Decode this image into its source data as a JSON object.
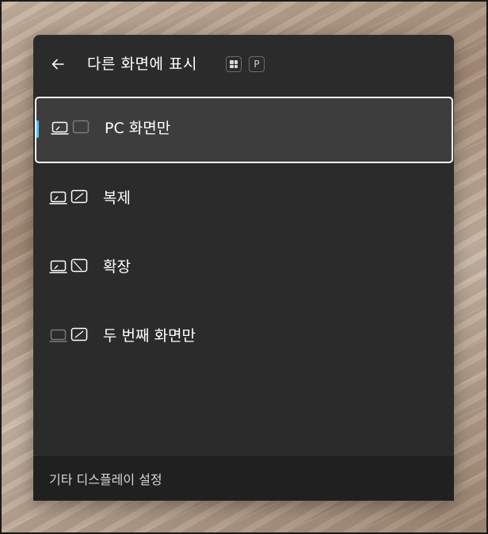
{
  "header": {
    "title": "다른 화면에 표시",
    "back_icon": "back-arrow-icon",
    "shortcut_keys": [
      "windows-key-icon",
      "P"
    ]
  },
  "options": [
    {
      "label": "PC 화면만",
      "icon": "pc-screen-only-icon",
      "selected": true
    },
    {
      "label": "복제",
      "icon": "duplicate-icon",
      "selected": false
    },
    {
      "label": "확장",
      "icon": "extend-icon",
      "selected": false
    },
    {
      "label": "두 번째 화면만",
      "icon": "second-screen-only-icon",
      "selected": false
    }
  ],
  "footer": {
    "link": "기타 디스플레이 설정"
  },
  "colors": {
    "panel_bg": "#2b2b2b",
    "selected_bg": "#3d3d3d",
    "accent": "#4cc2ff",
    "footer_bg": "#202020"
  }
}
